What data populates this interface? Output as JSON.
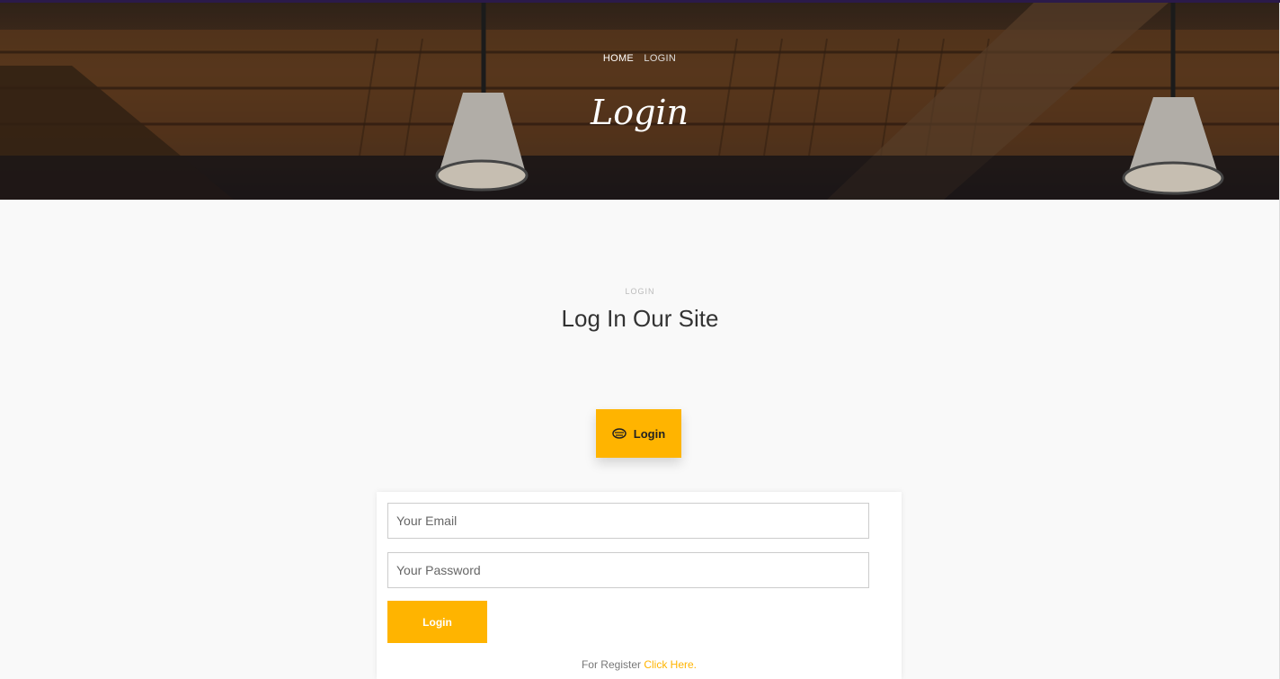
{
  "hero": {
    "breadcrumb": {
      "home": "HOME",
      "current": "LOGIN"
    },
    "title": "Login"
  },
  "section": {
    "kicker": "LOGIN",
    "heading": "Log In Our Site"
  },
  "tab": {
    "icon": "login-icon",
    "label": "Login"
  },
  "form": {
    "email_placeholder": "Your Email",
    "password_placeholder": "Your Password",
    "submit_label": "Login",
    "register_text": "For Register",
    "register_link": "Click Here."
  },
  "colors": {
    "accent": "#ffb400",
    "top_border": "#2b1a4a",
    "background": "#f9f9f9"
  }
}
